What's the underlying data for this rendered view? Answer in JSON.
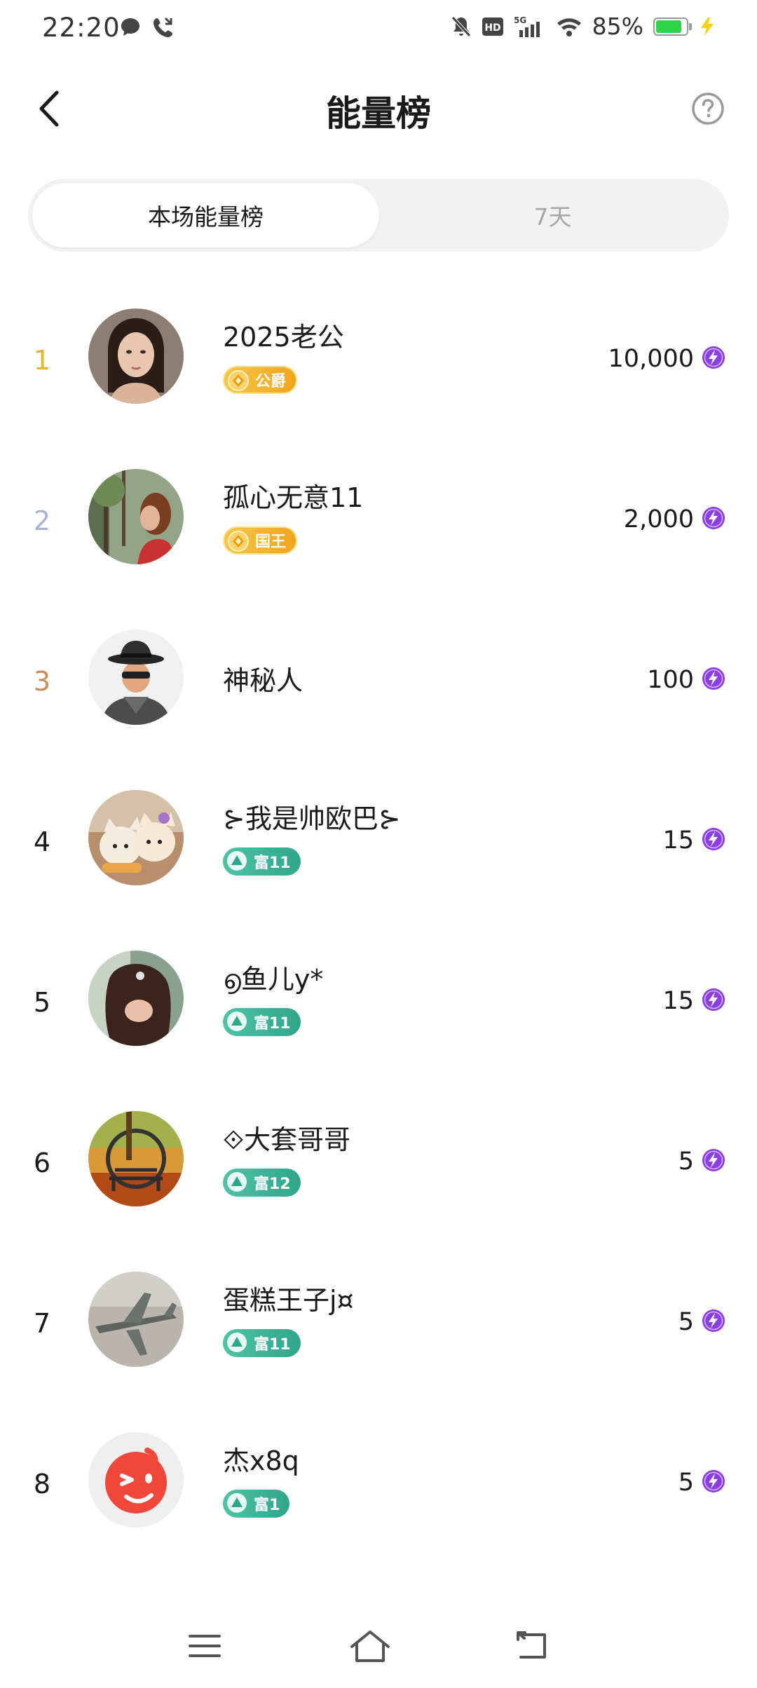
{
  "status_bar": {
    "time": "22:20",
    "battery_percent_text": "85%",
    "battery_level": 0.85,
    "icons_left": [
      "message-icon",
      "missed-call-icon"
    ],
    "icons_right": [
      "mute-icon",
      "hd-icon",
      "5g-signal-icon",
      "wifi-icon",
      "battery-icon",
      "charging-icon"
    ]
  },
  "header": {
    "title": "能量榜",
    "back_icon": "chevron-left-icon",
    "help_icon": "question-circle-icon"
  },
  "tabs": [
    {
      "label": "本场能量榜",
      "active": true
    },
    {
      "label": "7天",
      "active": false
    }
  ],
  "colors": {
    "rank_1": "#e5b530",
    "rank_2": "#a9b2d6",
    "rank_3": "#c98b58",
    "rank_default": "#1a1a1a",
    "gold_badge": "#f2b024",
    "green_badge": "#35ad92",
    "energy_icon": "#8b3ee6"
  },
  "leaderboard": [
    {
      "rank": "1",
      "name": "2025老公",
      "badge": "公爵",
      "badge_type": "gold",
      "score": "10,000",
      "avatar": "woman-portrait"
    },
    {
      "rank": "2",
      "name": "孤心无意11",
      "badge": "国王",
      "badge_type": "gold",
      "score": "2,000",
      "avatar": "forest-woman"
    },
    {
      "rank": "3",
      "name": "神秘人",
      "badge": "",
      "badge_type": "none",
      "score": "100",
      "avatar": "mystery-man"
    },
    {
      "rank": "4",
      "name": "⊱我是帅欧巴⊱",
      "badge": "富11",
      "badge_type": "green",
      "score": "15",
      "avatar": "plush-toys"
    },
    {
      "rank": "5",
      "name": "൭鱼儿y*",
      "badge": "富11",
      "badge_type": "green",
      "score": "15",
      "avatar": "girl-hair"
    },
    {
      "rank": "6",
      "name": "⟐大套哥哥",
      "badge": "富12",
      "badge_type": "green",
      "score": "5",
      "avatar": "autumn-bench"
    },
    {
      "rank": "7",
      "name": "蛋糕王子j¤",
      "badge": "富11",
      "badge_type": "green",
      "score": "5",
      "avatar": "fighter-jet"
    },
    {
      "rank": "8",
      "name": "杰x8q",
      "badge": "富1",
      "badge_type": "green",
      "score": "5",
      "avatar": "red-wink"
    }
  ],
  "nav_bar": {
    "icons": [
      "menu-icon",
      "home-icon",
      "back-nav-icon"
    ]
  }
}
